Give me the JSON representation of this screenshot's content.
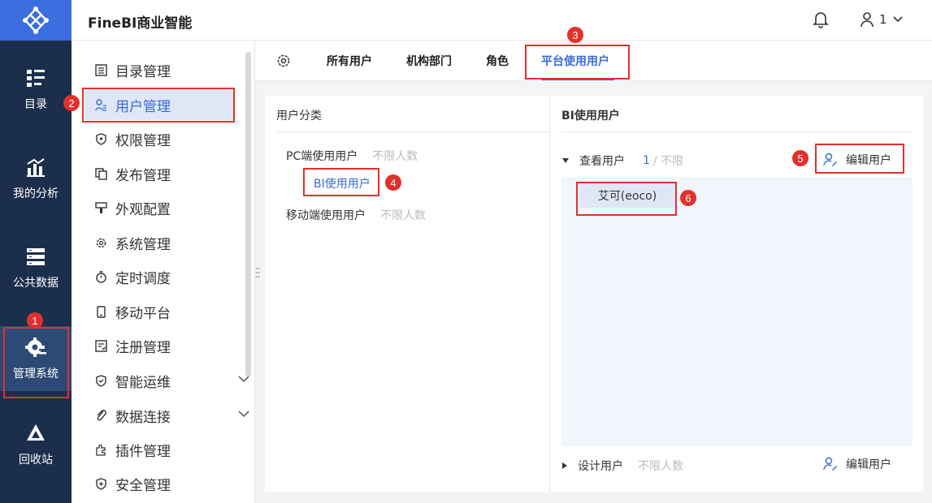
{
  "app": {
    "title": "FineBI商业智能"
  },
  "topbar": {
    "user_name": "1"
  },
  "rail": {
    "items": [
      {
        "label": "目录",
        "icon": "catalog-icon"
      },
      {
        "label": "我的分析",
        "icon": "analysis-icon"
      },
      {
        "label": "公共数据",
        "icon": "database-icon"
      },
      {
        "label": "管理系统",
        "icon": "gear-icon"
      },
      {
        "label": "回收站",
        "icon": "recycle-icon"
      }
    ]
  },
  "menu": {
    "items": [
      {
        "label": "目录管理",
        "icon": "list-icon"
      },
      {
        "label": "用户管理",
        "icon": "user-icon"
      },
      {
        "label": "权限管理",
        "icon": "shield-icon"
      },
      {
        "label": "发布管理",
        "icon": "copy-icon"
      },
      {
        "label": "外观配置",
        "icon": "brush-icon"
      },
      {
        "label": "系统管理",
        "icon": "gear-icon"
      },
      {
        "label": "定时调度",
        "icon": "timer-icon"
      },
      {
        "label": "移动平台",
        "icon": "phone-icon"
      },
      {
        "label": "注册管理",
        "icon": "register-icon"
      },
      {
        "label": "智能运维",
        "icon": "ops-icon"
      },
      {
        "label": "数据连接",
        "icon": "link-icon"
      },
      {
        "label": "插件管理",
        "icon": "plugin-icon"
      },
      {
        "label": "安全管理",
        "icon": "security-icon"
      }
    ]
  },
  "tabs": [
    {
      "label": "所有用户"
    },
    {
      "label": "机构部门"
    },
    {
      "label": "角色"
    },
    {
      "label": "平台使用用户"
    }
  ],
  "left_panel": {
    "title": "用户分类",
    "pc": {
      "label": "PC端使用用户",
      "limit": "不限人数"
    },
    "bi": {
      "label": "BI使用用户"
    },
    "mobile": {
      "label": "移动端使用用户",
      "limit": "不限人数"
    }
  },
  "right_panel": {
    "title": "BI使用用户",
    "view": {
      "label": "查看用户",
      "count": "1",
      "limit": "/ 不限",
      "edit": "编辑用户"
    },
    "user_chip": "艾可(eoco)",
    "design": {
      "label": "设计用户",
      "limit": "不限人数",
      "edit": "编辑用户"
    }
  },
  "annotations": [
    "1",
    "2",
    "3",
    "4",
    "5",
    "6"
  ],
  "colors": {
    "rail_bg": "#1b2e4c",
    "accent": "#3a6ad6",
    "annotation_red": "#e0312d"
  }
}
